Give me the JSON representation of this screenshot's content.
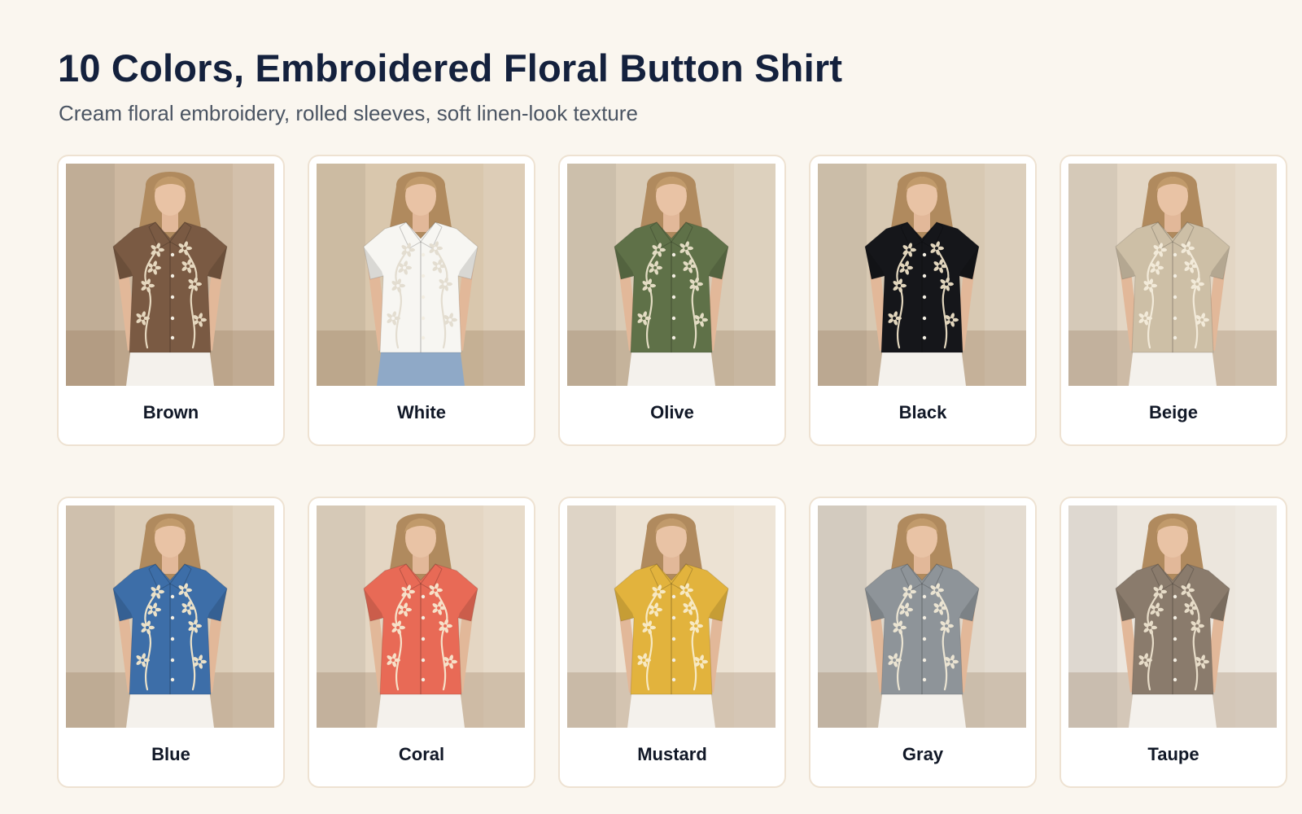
{
  "header": {
    "title": "10 Colors, Embroidered Floral Button Shirt",
    "subtitle": "Cream floral embroidery, rolled sleeves, soft linen-look texture"
  },
  "swatches": [
    {
      "label": "Brown",
      "shirt": "#7a5a43",
      "embroidery": "#e6d8bf",
      "bg": "#cdb8a0",
      "pants": "#f4f1ec"
    },
    {
      "label": "White",
      "shirt": "#f7f6f2",
      "embroidery": "#e3ddd0",
      "bg": "#d9c7ad",
      "pants": "#8fa9c7"
    },
    {
      "label": "Olive",
      "shirt": "#5f7148",
      "embroidery": "#e3dcc3",
      "bg": "#d9cbb6",
      "pants": "#f4f1ec"
    },
    {
      "label": "Black",
      "shirt": "#15161a",
      "embroidery": "#e2d6bd",
      "bg": "#d8c9b3",
      "pants": "#f4f1ec"
    },
    {
      "label": "Beige",
      "shirt": "#cdbfa6",
      "embroidery": "#f2ead9",
      "bg": "#e3d6c4",
      "pants": "#f4f1ec"
    },
    {
      "label": "Blue",
      "shirt": "#3d6ea8",
      "embroidery": "#ece2c9",
      "bg": "#dccdb8",
      "pants": "#f4f1ec"
    },
    {
      "label": "Coral",
      "shirt": "#e86a56",
      "embroidery": "#f6e1c9",
      "bg": "#e4d6c3",
      "pants": "#f4f1ec"
    },
    {
      "label": "Mustard",
      "shirt": "#e2b33d",
      "embroidery": "#f7e9c3",
      "bg": "#ece2d3",
      "pants": "#f4f1ec"
    },
    {
      "label": "Gray",
      "shirt": "#8e9499",
      "embroidery": "#ebe4d2",
      "bg": "#e1d8cb",
      "pants": "#f4f1ec"
    },
    {
      "label": "Taupe",
      "shirt": "#8a7b6c",
      "embroidery": "#e7dcc8",
      "bg": "#ece6dd",
      "pants": "#f4f1ec"
    }
  ]
}
